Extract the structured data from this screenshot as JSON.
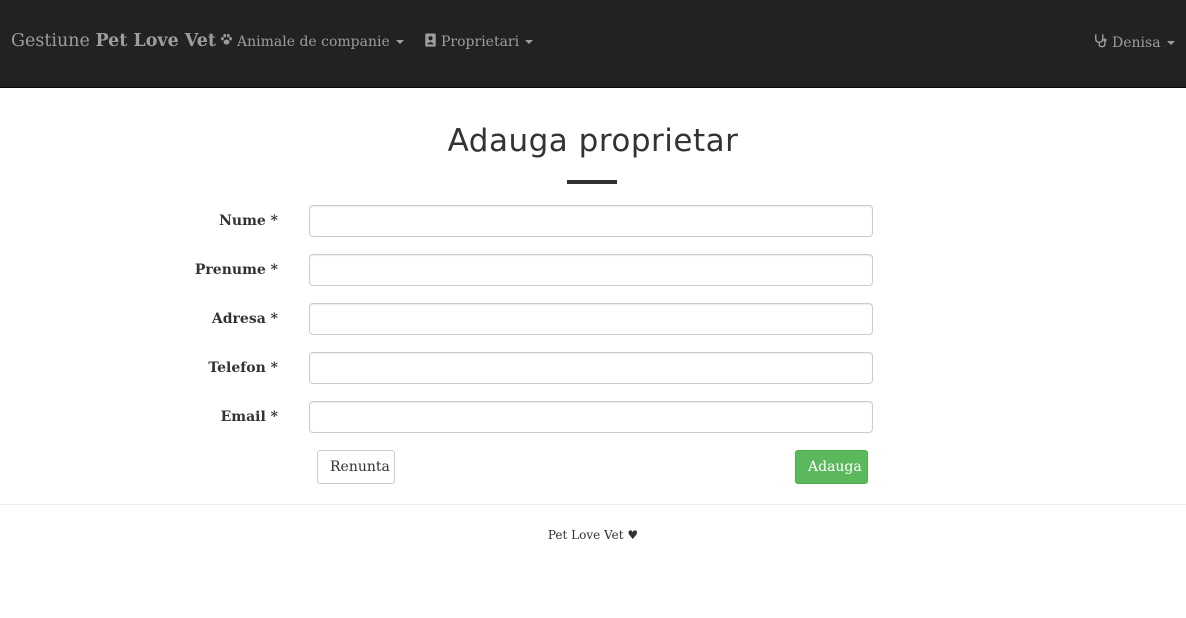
{
  "navbar": {
    "brand_prefix": "Gestiune",
    "brand_name": "Pet Love Vet",
    "menus": [
      {
        "label": "Animale de companie",
        "icon": "paw-icon"
      },
      {
        "label": "Proprietari",
        "icon": "address-book-icon"
      }
    ],
    "user": {
      "label": "Denisa",
      "icon": "stethoscope-icon"
    },
    "background_color": "#222222",
    "text_color": "#9d9d9d"
  },
  "main": {
    "title": "Adauga proprietar",
    "fields": [
      {
        "label": "Nume *",
        "value": "",
        "placeholder": ""
      },
      {
        "label": "Prenume *",
        "value": "",
        "placeholder": ""
      },
      {
        "label": "Adresa *",
        "value": "",
        "placeholder": ""
      },
      {
        "label": "Telefon *",
        "value": "",
        "placeholder": ""
      },
      {
        "label": "Email *",
        "value": "",
        "placeholder": ""
      }
    ],
    "cancel_label": "Renunta",
    "submit_label": "Adauga",
    "submit_color": "#5cb85c"
  },
  "footer": {
    "text": "Pet Love Vet ♥"
  }
}
